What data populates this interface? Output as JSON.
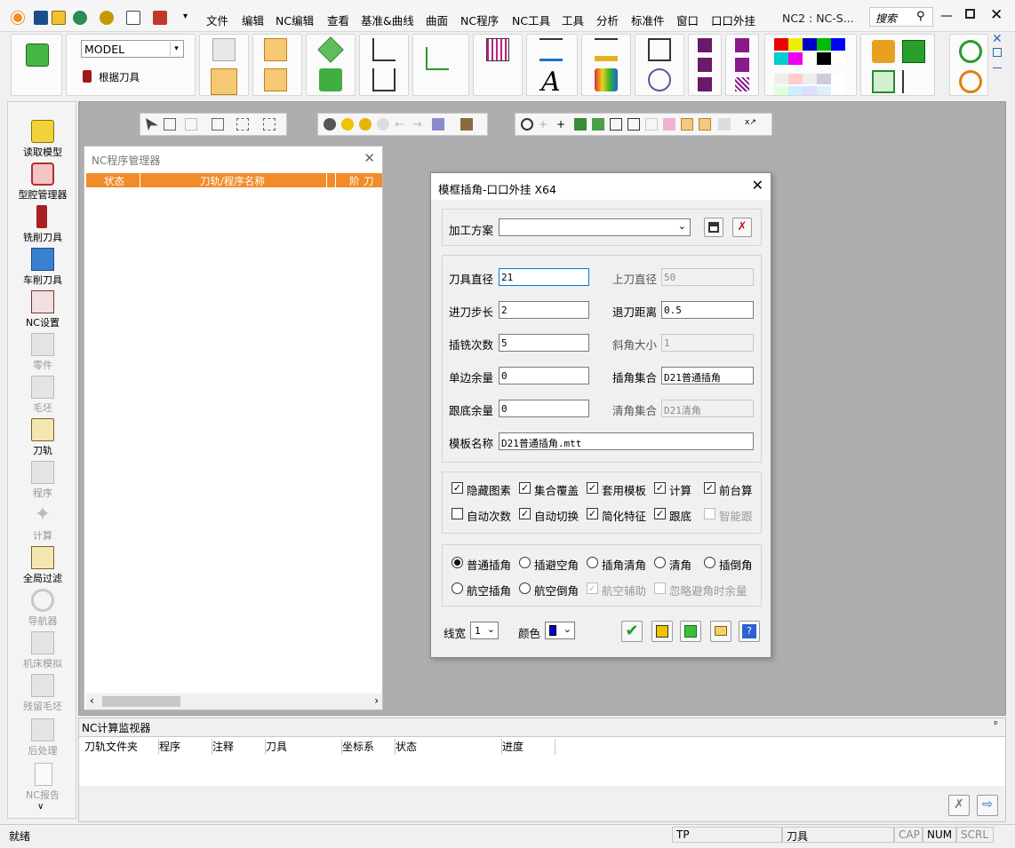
{
  "menubar": {
    "items": [
      "文件",
      "编辑",
      "NC编辑",
      "查看",
      "基准&曲线",
      "曲面",
      "NC程序",
      "NC工具",
      "工具",
      "分析",
      "标准件",
      "窗口",
      "口口外挂"
    ],
    "doc_title": "NC2 : NC-S...",
    "search_label": "搜索"
  },
  "toolbar": {
    "model_value": "MODEL",
    "by_tool_label": "根据刀具"
  },
  "sidebar": {
    "items": [
      {
        "label": "读取模型"
      },
      {
        "label": "型腔管理器"
      },
      {
        "label": "铣削刀具"
      },
      {
        "label": "车削刀具"
      },
      {
        "label": "NC设置"
      },
      {
        "label": "零件"
      },
      {
        "label": "毛坯"
      },
      {
        "label": "刀轨"
      },
      {
        "label": "程序"
      },
      {
        "label": "计算"
      },
      {
        "label": "全局过滤"
      },
      {
        "label": "导航器"
      },
      {
        "label": "机床模拟"
      },
      {
        "label": "残留毛坯"
      },
      {
        "label": "后处理"
      },
      {
        "label": "NC报告"
      }
    ]
  },
  "nc_panel": {
    "title": "NC程序管理器",
    "columns": [
      "状态",
      "刀轨/程序名称",
      "阶",
      "刀轨"
    ]
  },
  "dialog": {
    "title": "模框插角-口口外挂 X64",
    "scheme_label": "加工方案",
    "scheme_value": "",
    "fields": {
      "tool_diameter_label": "刀具直径",
      "tool_diameter": "21",
      "upper_tool_diameter_label": "上刀直径",
      "upper_tool_diameter": "50",
      "feed_step_label": "进刀步长",
      "feed_step": "2",
      "retract_distance_label": "退刀距离",
      "retract_distance": "0.5",
      "plunge_count_label": "插铣次数",
      "plunge_count": "5",
      "chamfer_size_label": "斜角大小",
      "chamfer_size": "1",
      "side_stock_label": "单边余量",
      "side_stock": "0",
      "corner_set_label": "插角集合",
      "corner_set": "D21普通插角",
      "floor_stock_label": "跟底余量",
      "floor_stock": "0",
      "clean_set_label": "清角集合",
      "clean_set": "D21清角",
      "template_name_label": "模板名称",
      "template_name": "D21普通插角.mtt"
    },
    "checkboxes": [
      {
        "label": "隐藏图素",
        "checked": true,
        "enabled": true
      },
      {
        "label": "集合覆盖",
        "checked": true,
        "enabled": true
      },
      {
        "label": "套用模板",
        "checked": true,
        "enabled": true
      },
      {
        "label": "计算",
        "checked": true,
        "enabled": true
      },
      {
        "label": "前台算",
        "checked": true,
        "enabled": true
      },
      {
        "label": "自动次数",
        "checked": false,
        "enabled": true
      },
      {
        "label": "自动切换",
        "checked": true,
        "enabled": true
      },
      {
        "label": "简化特征",
        "checked": true,
        "enabled": true
      },
      {
        "label": "跟底",
        "checked": true,
        "enabled": true
      },
      {
        "label": "智能跟",
        "checked": false,
        "enabled": false
      }
    ],
    "radios": [
      {
        "label": "普通插角",
        "selected": true
      },
      {
        "label": "插避空角",
        "selected": false
      },
      {
        "label": "插角清角",
        "selected": false
      },
      {
        "label": "清角",
        "selected": false
      },
      {
        "label": "插倒角",
        "selected": false
      },
      {
        "label": "航空插角",
        "selected": false
      },
      {
        "label": "航空倒角",
        "selected": false
      }
    ],
    "extra_options": [
      {
        "label": "航空辅助",
        "checked": true,
        "enabled": false
      },
      {
        "label": "忽略避角时余量",
        "checked": false,
        "enabled": false
      }
    ],
    "linewidth_label": "线宽",
    "linewidth_value": "1",
    "color_label": "颜色",
    "color_value": "#0000cc"
  },
  "monitor": {
    "title": "NC计算监视器",
    "pin": "ᵖ",
    "columns": [
      "刀轨文件夹",
      "程序",
      "注释",
      "刀具",
      "坐标系",
      "状态",
      "进度"
    ]
  },
  "statusbar": {
    "ready": "就绪",
    "tp": "TP",
    "tool": "刀具",
    "cap": "CAP",
    "num": "NUM",
    "scrl": "SCRL"
  },
  "colors": {
    "accent": "#0078d7",
    "header_orange": "#f28c28",
    "ok_green": "#1a9e1a",
    "cancel_red": "#d01010"
  }
}
